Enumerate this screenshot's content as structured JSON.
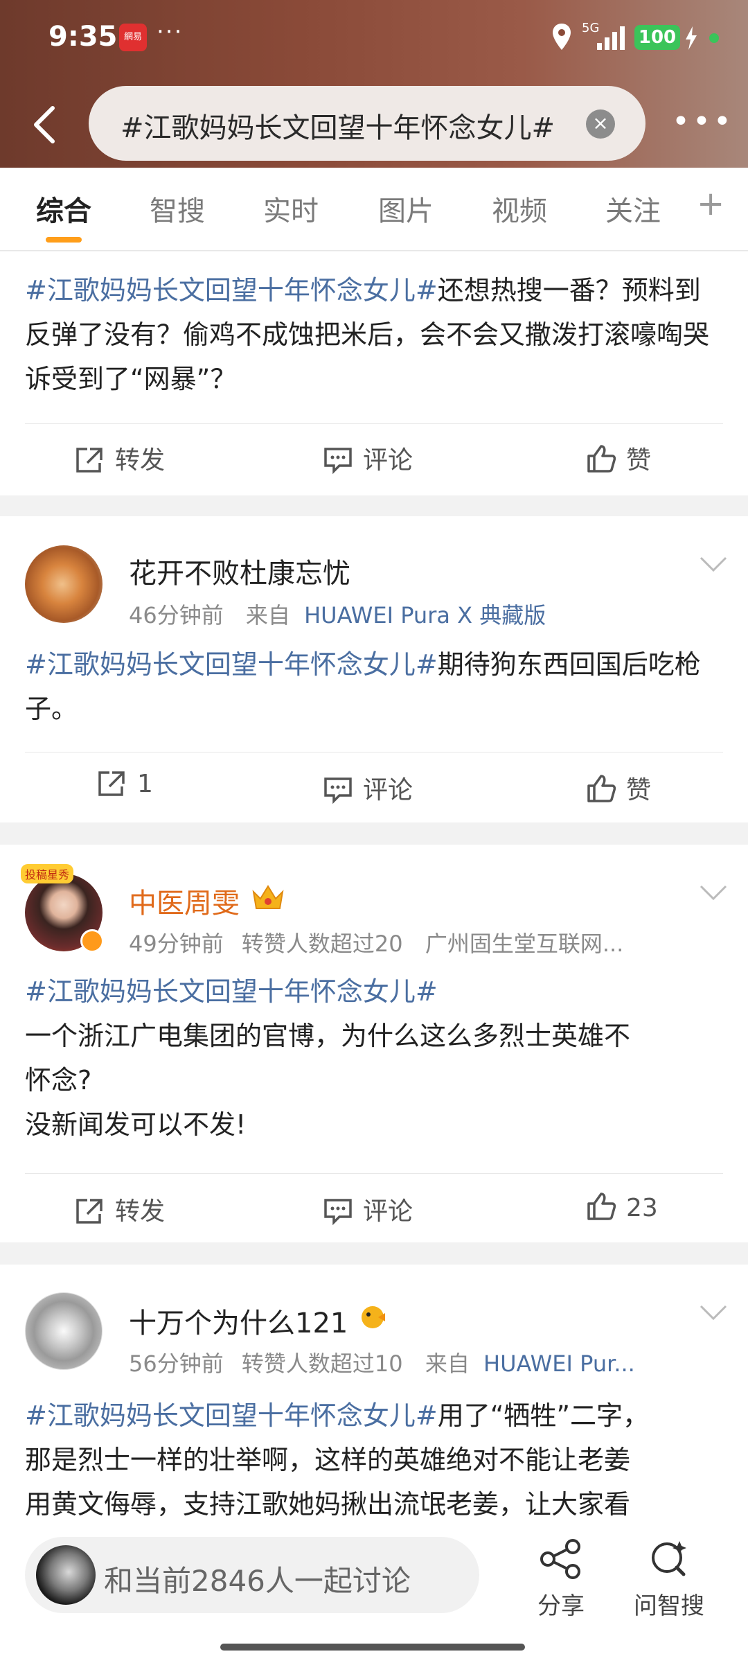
{
  "status_bar": {
    "time": "9:35",
    "app_badge": "網易",
    "dots": "···",
    "signal": "5G",
    "battery": "100"
  },
  "search": {
    "query": "#江歌妈妈长文回望十年怀念女儿#",
    "clear_icon": "close-icon",
    "more": "•••"
  },
  "tabs": [
    {
      "label": "综合",
      "active": true
    },
    {
      "label": "智搜"
    },
    {
      "label": "实时"
    },
    {
      "label": "图片"
    },
    {
      "label": "视频"
    },
    {
      "label": "关注"
    }
  ],
  "tabs_plus": "+",
  "posts": [
    {
      "hashtag": "#江歌妈妈长文回望十年怀念女儿#",
      "body": "还想热搜一番？预料到反弹了没有？偷鸡不成蚀把米后，会不会又撒泼打滚嚎啕哭诉受到了“网暴”？",
      "actions": {
        "repost": "转发",
        "comment": "评论",
        "like": "赞"
      }
    },
    {
      "username": "花开不败杜康忘忧",
      "time": "46分钟前",
      "source_prefix": "来自",
      "source": "HUAWEI Pura X 典藏版",
      "hashtag": "#江歌妈妈长文回望十年怀念女儿#",
      "body": "期待狗东西回国后吃枪子。",
      "actions": {
        "repost": "1",
        "comment": "评论",
        "like": "赞"
      }
    },
    {
      "username": "中医周雯",
      "avatar_badge": "投稿星秀",
      "time": "49分钟前",
      "extra": "转赞人数超过20",
      "source": "广州固生堂互联网...",
      "hashtag": "#江歌妈妈长文回望十年怀念女儿#",
      "body_lines": [
        "一个浙江广电集团的官博，为什么这么多烈士英雄不",
        "怀念?",
        "没新闻发可以不发!"
      ],
      "actions": {
        "repost": "转发",
        "comment": "评论",
        "like": "23"
      }
    },
    {
      "username": "十万个为什么121",
      "time": "56分钟前",
      "extra": "转赞人数超过10",
      "source_prefix": "来自",
      "source": "HUAWEI Pur...",
      "hashtag": "#江歌妈妈长文回望十年怀念女儿#",
      "body_lines": [
        "用了“牺牲”二字，",
        "那是烈士一样的壮举啊，这样的英雄绝对不能让老姜",
        "用黄文侮辱，支持江歌她妈揪出流氓老姜，让大家看"
      ]
    }
  ],
  "bottom": {
    "discuss_text": "和当前2846人一起讨论",
    "share_label": "分享",
    "ask_label": "问智搜"
  },
  "colors": {
    "hashtag": "#4a6ea1",
    "accent": "#ff9e1a",
    "vip_name": "#e06a1a"
  }
}
